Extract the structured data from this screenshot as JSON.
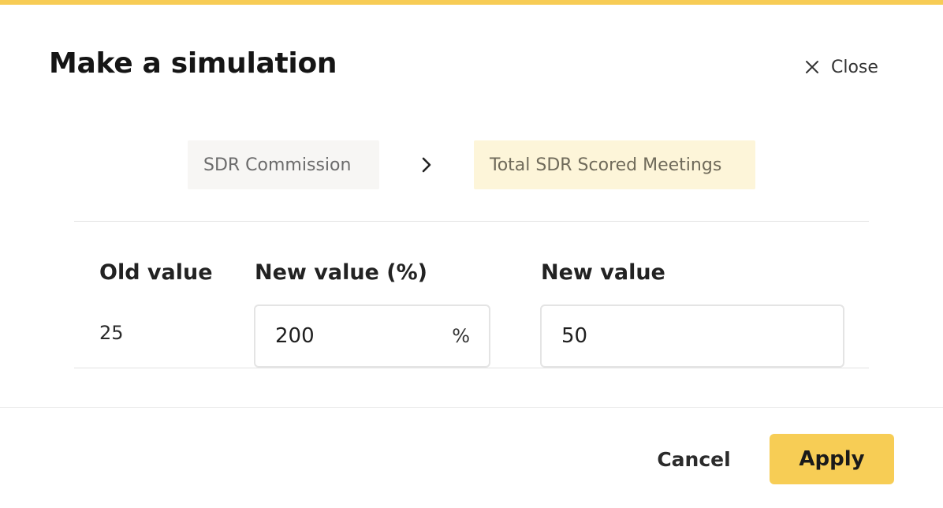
{
  "colors": {
    "accent": "#f7cd55",
    "chip_inactive_bg": "#f7f6f4",
    "chip_active_bg": "#fdf5d9"
  },
  "dialog": {
    "title": "Make a simulation",
    "close_label": "Close",
    "close_icon": "close-icon"
  },
  "breadcrumb": {
    "items": [
      {
        "label": "SDR Commission"
      },
      {
        "label": "Total SDR Scored Meetings"
      }
    ],
    "separator_icon": "chevron-right-icon"
  },
  "form": {
    "old_value_label": "Old value",
    "old_value": "25",
    "new_value_pct_label": "New value (%)",
    "new_value_pct": "200",
    "pct_suffix": "%",
    "new_value_label": "New value",
    "new_value": "50"
  },
  "footer": {
    "cancel_label": "Cancel",
    "apply_label": "Apply"
  }
}
